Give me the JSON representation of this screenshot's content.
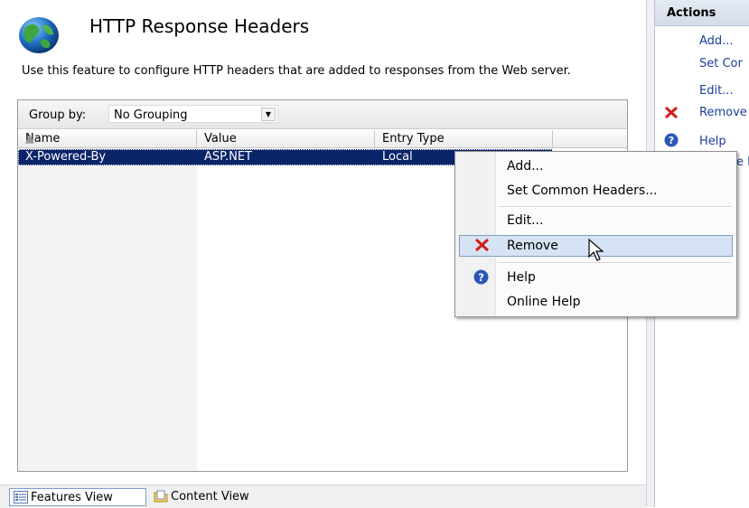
{
  "page": {
    "title": "HTTP Response Headers",
    "description": "Use this feature to configure HTTP headers that are added to responses from the Web server."
  },
  "grouping": {
    "label": "Group by:",
    "value": "No Grouping"
  },
  "columns": [
    "Name",
    "Value",
    "Entry Type"
  ],
  "rows": [
    {
      "name": "X-Powered-By",
      "value": "ASP.NET",
      "entry_type": "Local"
    }
  ],
  "context_menu": {
    "items": [
      "Add...",
      "Set Common Headers...",
      "Edit...",
      "Remove",
      "Help",
      "Online Help"
    ],
    "highlighted": "Remove"
  },
  "actions": {
    "header": "Actions",
    "items": [
      "Add...",
      "Set Cor",
      "Edit...",
      "Remove",
      "Help",
      "e I"
    ]
  },
  "view_tabs": {
    "features": "Features View",
    "content": "Content View"
  },
  "colors": {
    "selection": "#0a246a",
    "link": "#1a3f9a",
    "remove_icon": "#d41c1c",
    "help_icon": "#2a56b8"
  }
}
